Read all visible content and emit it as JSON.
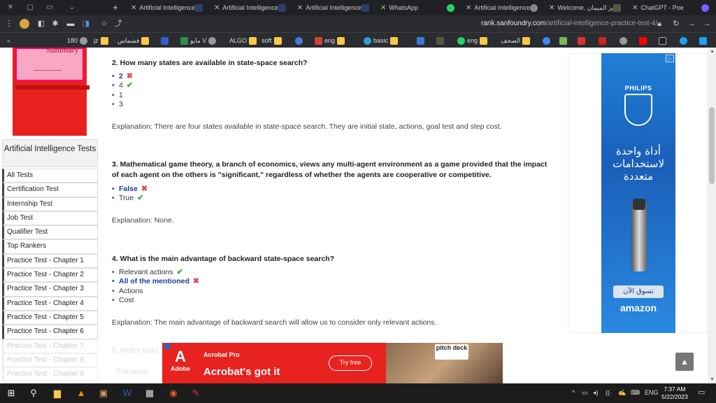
{
  "browser": {
    "tabs": [
      {
        "title": "Artificial Intelligence"
      },
      {
        "title": "Artificial Intelligence"
      },
      {
        "title": "Artificial Intelligence"
      },
      {
        "title": "WhatsApp"
      },
      {
        "title": "Artificial Intelligence:"
      },
      {
        "title": "Welcome, عزيز الميمان"
      },
      {
        "title": "ChatGPT - Poe"
      }
    ],
    "url_host": "rank.sanfoundry.com",
    "url_path": "/artificial-intelligence-practice-test-4/",
    "bookmarks": [
      "180",
      "jz",
      "فشماس",
      "مايو V",
      "ALGO",
      "soft",
      "eng",
      "basic",
      "eng",
      "الصحف"
    ]
  },
  "sidebar": {
    "banner_text": "Summary",
    "heading": "Artificial Intelligence Tests",
    "items": [
      {
        "label": "All Tests"
      },
      {
        "label": "Certification Test"
      },
      {
        "label": "Internship Test"
      },
      {
        "label": "Job Test"
      },
      {
        "label": "Qualifier Test"
      },
      {
        "label": "Top Rankers"
      },
      {
        "label": "Practice Test - Chapter 1"
      },
      {
        "label": "Practice Test - Chapter 2"
      },
      {
        "label": "Practice Test - Chapter 3"
      },
      {
        "label": "Practice Test - Chapter 4"
      },
      {
        "label": "Practice Test - Chapter 5"
      },
      {
        "label": "Practice Test - Chapter 6"
      },
      {
        "label": "Practice Test - Chapter 7"
      },
      {
        "label": "Practice Test - Chapter 8"
      },
      {
        "label": "Practice Test - Chapter 9"
      }
    ]
  },
  "questions": [
    {
      "text": "2. How many states are available in state-space search?",
      "options": [
        {
          "label": "2",
          "selected": true,
          "mark": "wrong"
        },
        {
          "label": "4",
          "selected": false,
          "mark": "correct"
        },
        {
          "label": "1",
          "selected": false,
          "mark": ""
        },
        {
          "label": "3",
          "selected": false,
          "mark": ""
        }
      ],
      "explanation": "Explanation: There are four states available in state-space search. They are initial state, actions, goal test and step cost."
    },
    {
      "text": "3. Mathematical game theory, a branch of economics, views any multi-agent environment as a game provided that the impact of each agent on the others is \"significant,\" regardless of whether the agents are cooperative or competitive.",
      "options": [
        {
          "label": "False",
          "selected": true,
          "mark": "wrong"
        },
        {
          "label": "True",
          "selected": false,
          "mark": "correct"
        }
      ],
      "explanation": "Explanation: None."
    },
    {
      "text": "4. What is the main advantage of backward state-space search?",
      "options": [
        {
          "label": "Relevant actions",
          "selected": false,
          "mark": "correct"
        },
        {
          "label": "All of the mentioned",
          "selected": true,
          "mark": "wrong"
        },
        {
          "label": "Actions",
          "selected": false,
          "mark": ""
        },
        {
          "label": "Cost",
          "selected": false,
          "mark": ""
        }
      ],
      "explanation": "Explanation: The main advantage of backward search will allow us to consider only relevant actions."
    }
  ],
  "faded_next": {
    "question": "5. Which funct",
    "option": "Transposi"
  },
  "right_ad": {
    "brand": "PHILIPS",
    "line1": "أداة واحدة",
    "line2": "لاستخدامات",
    "line3": "متعددة",
    "button": "تسوق الآن",
    "store": "amazon"
  },
  "bottom_ad": {
    "logo_text": "Adobe",
    "product": "Acrobat Pro",
    "headline": "Acrobat's got it",
    "button": "Try free",
    "photo_label": "pitch deck"
  },
  "taskbar": {
    "lang": "ENG",
    "time": "7:37 AM",
    "date": "5/22/2023"
  },
  "colors": {
    "selected_option": "#1a3d9e",
    "wrong_mark": "#e24c4c",
    "correct_mark": "#39a845",
    "ad_red": "#e8231f",
    "philips_blue": "#1f7fd6"
  }
}
